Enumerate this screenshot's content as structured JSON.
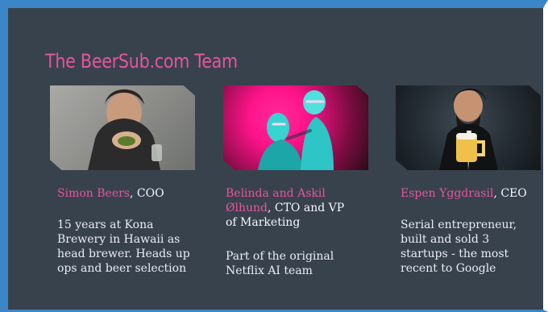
{
  "slide": {
    "title": "The BeerSub.com Team",
    "accent_color": "#e5559c",
    "frame_color": "#3a86c6",
    "background_color": "#38424d",
    "members": [
      {
        "name": "Simon Beers",
        "role": ", COO",
        "description": [
          "15 years at Kona",
          "Brewery in Hawaii as",
          "head brewer. Heads up",
          "ops and beer selection"
        ]
      },
      {
        "name": "Belinda and Askil",
        "name_line2": "Ølhund",
        "role": ", CTO and VP",
        "role_line2": "of Marketing",
        "description": [
          "Part of the original",
          "Netflix AI team"
        ]
      },
      {
        "name": "Espen Yggdrasil",
        "role": ", CEO",
        "description": [
          "Serial entrepreneur,",
          "built and sold 3",
          "startups - the most",
          "recent to Google"
        ]
      }
    ]
  }
}
